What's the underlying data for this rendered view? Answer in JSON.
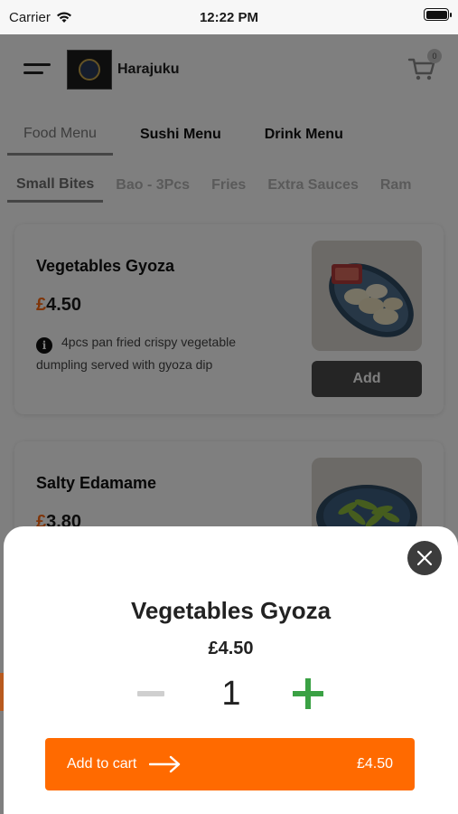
{
  "status": {
    "carrier": "Carrier",
    "time": "12:22 PM"
  },
  "header": {
    "brand": "Harajuku",
    "cart_count": "0"
  },
  "tabs": [
    {
      "label": "Food Menu",
      "active": true
    },
    {
      "label": "Sushi Menu"
    },
    {
      "label": "Drink Menu"
    }
  ],
  "subtabs": [
    {
      "label": "Small Bites",
      "active": true
    },
    {
      "label": "Bao - 3Pcs"
    },
    {
      "label": "Fries"
    },
    {
      "label": "Extra Sauces"
    },
    {
      "label": "Ram"
    }
  ],
  "items": [
    {
      "name": "Vegetables Gyoza",
      "currency": "£",
      "amount": "4.50",
      "description": "4pcs pan fried crispy vegetable dumpling served with gyoza dip",
      "add_label": "Add"
    },
    {
      "name": "Salty Edamame",
      "currency": "£",
      "amount": "3.80"
    }
  ],
  "sheet": {
    "title": "Vegetables Gyoza",
    "price": "£4.50",
    "quantity": "1",
    "add_to_cart_label": "Add to cart",
    "total": "£4.50"
  },
  "colors": {
    "accent": "#ff6a00",
    "plus": "#3aa144",
    "price_currency": "#ff6a13"
  }
}
